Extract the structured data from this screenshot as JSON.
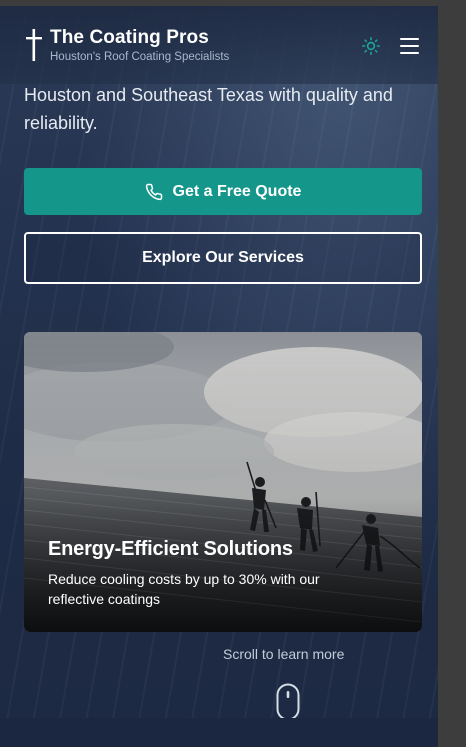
{
  "header": {
    "brand_name": "The Coating Pros",
    "tagline": "Houston's Roof Coating Specialists",
    "logo_icon": "cross-icon",
    "theme_toggle_icon": "sun-icon",
    "menu_icon": "hamburger-menu-icon"
  },
  "hero": {
    "description": "Houston and Southeast Texas with quality and reliability.",
    "primary_cta": {
      "label": "Get a Free Quote",
      "icon": "phone-icon"
    },
    "secondary_cta": {
      "label": "Explore Our Services"
    }
  },
  "feature_card": {
    "title": "Energy-Efficient Solutions",
    "description": "Reduce cooling costs by up to 30% with our reflective coatings"
  },
  "scroll_hint": {
    "label": "Scroll to learn more",
    "icon": "mouse-scroll-icon"
  },
  "colors": {
    "accent": "#15968a",
    "background": "#243350",
    "text": "#ffffff",
    "muted_text": "#aab8cc"
  }
}
